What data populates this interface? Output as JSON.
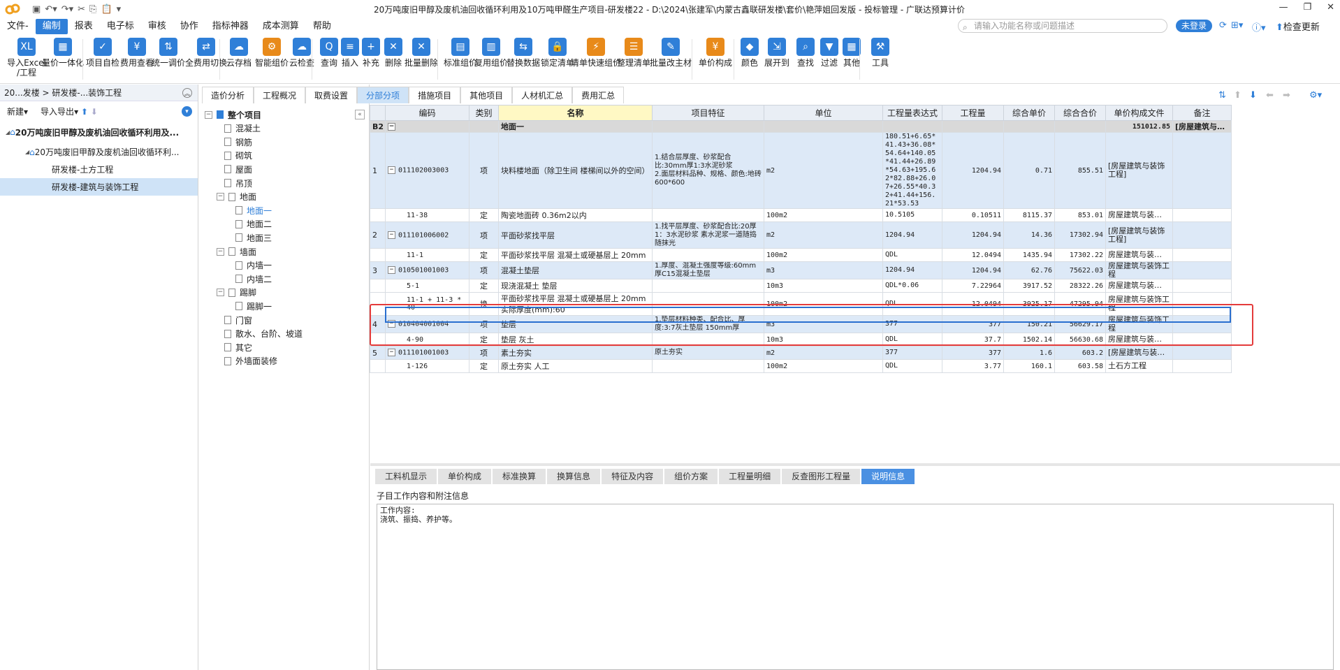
{
  "app": {
    "title": "20万吨废旧甲醇及废机油回收循环利用及10万吨甲醛生产项目-研发楼22 - D:\\2024\\张建军\\内蒙古鑫联研发楼\\套价\\艳萍姐回发版 - 投标管理 - 广联达预算计价"
  },
  "menubar": {
    "items": [
      "文件-",
      "编制",
      "报表",
      "电子标",
      "审核",
      "协作",
      "指标神器",
      "成本测算",
      "帮助"
    ],
    "search_placeholder": "请输入功能名称或问题描述",
    "login": "未登录",
    "check_update": "检查更新"
  },
  "ribbon": [
    {
      "label": "导入Excel",
      "label2": "/工程",
      "color": "#2f7fd8",
      "icon": "XL"
    },
    {
      "label": "量价一体化",
      "color": "#2f7fd8",
      "icon": "▦"
    },
    {
      "label": "项目自检",
      "color": "#2f7fd8",
      "icon": "✓"
    },
    {
      "label": "费用查看",
      "color": "#2f7fd8",
      "icon": "¥"
    },
    {
      "label": "统一调价",
      "color": "#2f7fd8",
      "icon": "⇅"
    },
    {
      "label": "全费用切换",
      "color": "#2f7fd8",
      "icon": "⇄"
    },
    {
      "label": "云存档",
      "color": "#2f7fd8",
      "icon": "☁"
    },
    {
      "label": "智能组价",
      "color": "#e88a1a",
      "icon": "⚙"
    },
    {
      "label": "云检查",
      "color": "#2f7fd8",
      "icon": "☁"
    },
    {
      "label": "查询",
      "color": "#2f7fd8",
      "icon": "Q"
    },
    {
      "label": "插入",
      "color": "#2f7fd8",
      "icon": "≡"
    },
    {
      "label": "补充",
      "color": "#2f7fd8",
      "icon": "+"
    },
    {
      "label": "删除",
      "color": "#2f7fd8",
      "icon": "✕"
    },
    {
      "label": "批量删除",
      "color": "#2f7fd8",
      "icon": "✕"
    },
    {
      "label": "标准组价",
      "color": "#2f7fd8",
      "icon": "▤"
    },
    {
      "label": "复用组价",
      "color": "#2f7fd8",
      "icon": "▥"
    },
    {
      "label": "替换数据",
      "color": "#2f7fd8",
      "icon": "⇆"
    },
    {
      "label": "锁定清单",
      "color": "#2f7fd8",
      "icon": "🔒"
    },
    {
      "label": "清单快速组价",
      "color": "#e88a1a",
      "icon": "⚡"
    },
    {
      "label": "整理清单",
      "color": "#e88a1a",
      "icon": "☰"
    },
    {
      "label": "批量改主材",
      "color": "#2f7fd8",
      "icon": "✎"
    },
    {
      "label": "单价构成",
      "color": "#e88a1a",
      "icon": "¥"
    },
    {
      "label": "颜色",
      "color": "#2f7fd8",
      "icon": "◆"
    },
    {
      "label": "展开到",
      "color": "#2f7fd8",
      "icon": "⇲"
    },
    {
      "label": "查找",
      "color": "#2f7fd8",
      "icon": "⌕"
    },
    {
      "label": "过滤",
      "color": "#2f7fd8",
      "icon": "▼"
    },
    {
      "label": "其他",
      "color": "#2f7fd8",
      "icon": "▦"
    },
    {
      "label": "工具",
      "color": "#2f7fd8",
      "icon": "⚒"
    }
  ],
  "left": {
    "breadcrumb": "20...发楼 > 研发楼-...装饰工程",
    "new_label": "新建",
    "import_label": "导入导出",
    "tree": [
      {
        "label": "20万吨废旧甲醇及废机油回收循环利用及...",
        "bold": true
      },
      {
        "label": "20万吨废旧甲醇及废机油回收循环利..."
      },
      {
        "label": "研发楼-土方工程"
      },
      {
        "label": "研发楼-建筑与装饰工程",
        "selected": true
      }
    ]
  },
  "mid": {
    "nodes": [
      "整个项目",
      "混凝土",
      "钢筋",
      "砌筑",
      "屋面",
      "吊顶",
      "地面",
      "地面一",
      "地面二",
      "地面三",
      "墙面",
      "内墙一",
      "内墙二",
      "踢脚",
      "踢脚一",
      "门窗",
      "散水、台阶、坡道",
      "其它",
      "外墙面装修"
    ]
  },
  "tabs": [
    "造价分析",
    "工程概况",
    "取费设置",
    "分部分项",
    "措施项目",
    "其他项目",
    "人材机汇总",
    "费用汇总"
  ],
  "grid": {
    "headers": [
      "编码",
      "类别",
      "名称",
      "项目特征",
      "单位",
      "工程量表达式",
      "工程量",
      "综合单价",
      "综合合价",
      "单价构成文件",
      "备注"
    ],
    "section": {
      "code": "B2",
      "name": "地面一",
      "total": "151012.85",
      "file": "[房屋建筑与…"
    },
    "rows": [
      {
        "idx": "1",
        "code": "011102003003",
        "type": "项",
        "name": "块料楼地面（除卫生间 楼梯间以外的空间）",
        "feature": "1.结合层厚度、砂浆配合比:30mm厚1:3水泥砂浆\n2.面层材料品种、规格、颜色:地砖600*600",
        "unit": "m2",
        "expr": "180.51+6.65*41.43+36.08*54.64+140.05*41.44+26.89*54.63+195.62*82.88+26.07+26.55*40.32+41.44+156.21*53.53",
        "qty": "1204.94",
        "price": "0.71",
        "total": "855.51",
        "file": "[房屋建筑与装饰工程]"
      },
      {
        "idx": "",
        "code": "11-38",
        "type": "定",
        "name": "陶瓷地面砖 0.36m2以内",
        "feature": "",
        "unit": "100m2",
        "expr": "10.5105",
        "qty": "0.10511",
        "price": "8115.37",
        "total": "853.01",
        "file": "房屋建筑与装…"
      },
      {
        "idx": "2",
        "code": "011101006002",
        "type": "项",
        "name": "平面砂浆找平层",
        "feature": "1.找平层厚度、砂浆配合比:20厚1：3水泥砂浆 素水泥浆一道随捣随抹光",
        "unit": "m2",
        "expr": "1204.94",
        "qty": "1204.94",
        "price": "14.36",
        "total": "17302.94",
        "file": "[房屋建筑与装饰工程]"
      },
      {
        "idx": "",
        "code": "11-1",
        "type": "定",
        "name": "平面砂浆找平层 混凝土或硬基层上 20mm",
        "feature": "",
        "unit": "100m2",
        "expr": "QDL",
        "qty": "12.0494",
        "price": "1435.94",
        "total": "17302.22",
        "file": "房屋建筑与装…"
      },
      {
        "idx": "3",
        "code": "010501001003",
        "type": "项",
        "name": "混凝土垫层",
        "feature": "1.厚度、混凝土强度等级:60mm厚C15混凝土垫层",
        "unit": "m3",
        "expr": "1204.94",
        "qty": "1204.94",
        "price": "62.76",
        "total": "75622.03",
        "file": "房屋建筑与装饰工程"
      },
      {
        "idx": "",
        "code": "5-1",
        "type": "定",
        "name": "现浇混凝土 垫层",
        "feature": "",
        "unit": "10m3",
        "expr": "QDL*0.06",
        "qty": "7.22964",
        "price": "3917.52",
        "total": "28322.26",
        "file": "房屋建筑与装…"
      },
      {
        "idx": "",
        "code": "11-1 + 11-3 * 40",
        "type": "换",
        "name": "平面砂浆找平层 混凝土或硬基层上 20mm 实际厚度(mm):60",
        "feature": "",
        "unit": "100m2",
        "expr": "QDL",
        "qty": "12.0494",
        "price": "3925.17",
        "total": "47295.94",
        "file": "房屋建筑与装饰工程"
      },
      {
        "idx": "4",
        "code": "010404001004",
        "type": "项",
        "name": "垫层",
        "feature": "1.垫层材料种类、配合比、厚度:3:7灰土垫层 150mm厚",
        "unit": "m3",
        "expr": "377",
        "qty": "377",
        "price": "150.21",
        "total": "56629.17",
        "file": "房屋建筑与装饰工程"
      },
      {
        "idx": "",
        "code": "4-90",
        "type": "定",
        "name": "垫层 灰土",
        "feature": "",
        "unit": "10m3",
        "expr": "QDL",
        "qty": "37.7",
        "price": "1502.14",
        "total": "56630.68",
        "file": "房屋建筑与装…"
      },
      {
        "idx": "5",
        "code": "011101001003",
        "type": "项",
        "name": "素土夯实",
        "feature": "原土夯实",
        "unit": "m2",
        "expr": "377",
        "qty": "377",
        "price": "1.6",
        "total": "603.2",
        "file": "[房屋建筑与装…"
      },
      {
        "idx": "",
        "code": "1-126",
        "type": "定",
        "name": "原土夯实 人工",
        "feature": "",
        "unit": "100m2",
        "expr": "QDL",
        "qty": "3.77",
        "price": "160.1",
        "total": "603.58",
        "file": "土石方工程"
      }
    ]
  },
  "bottom": {
    "tabs": [
      "工料机显示",
      "单价构成",
      "标准换算",
      "换算信息",
      "特征及内容",
      "组价方案",
      "工程量明细",
      "反查图形工程量",
      "说明信息"
    ],
    "info_label": "子目工作内容和附注信息",
    "info_lines": [
      "工作内容:",
      "浇筑、振捣、养护等。"
    ]
  }
}
